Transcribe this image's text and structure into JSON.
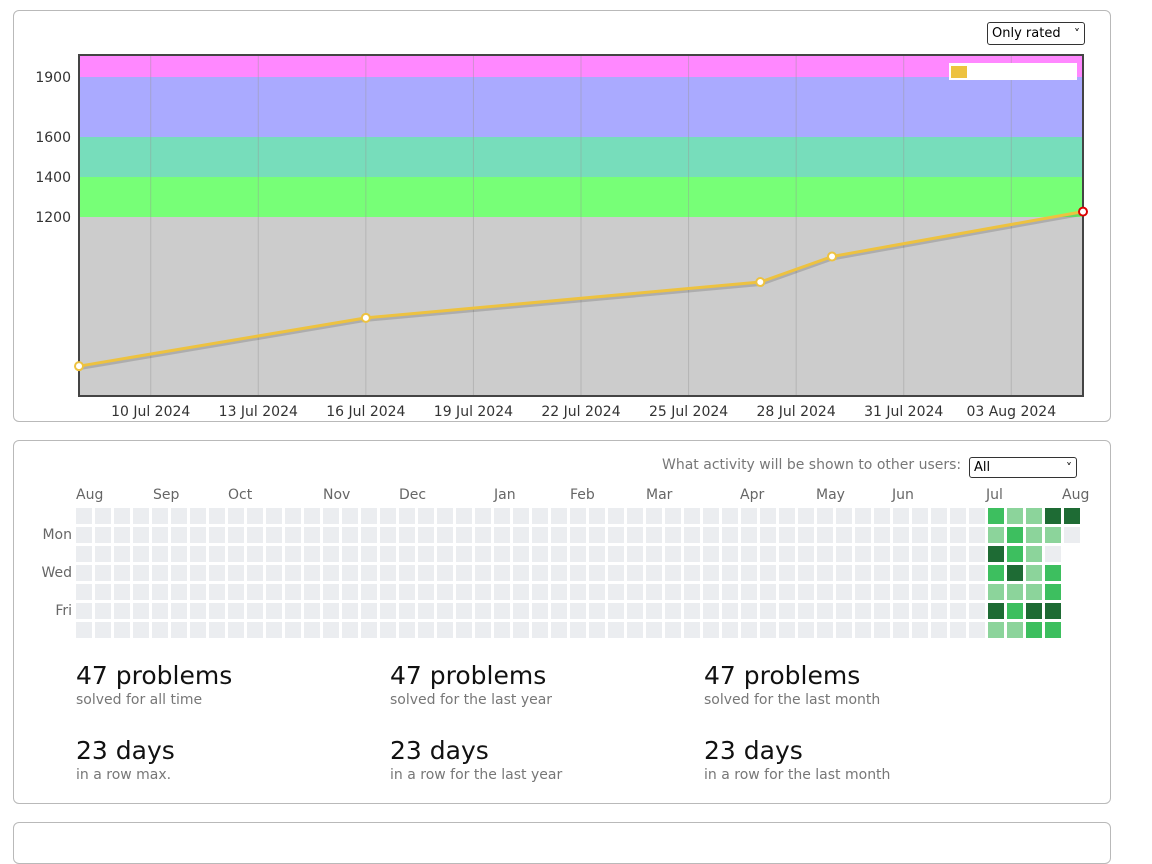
{
  "rating": {
    "filter": {
      "selected": "Only rated"
    },
    "chart_data": {
      "type": "line",
      "title": "",
      "ylabel": "",
      "xlabel": "",
      "y_ticks": [
        1200,
        1400,
        1600,
        1900
      ],
      "x_tick_labels": [
        "10 Jul 2024",
        "13 Jul 2024",
        "16 Jul 2024",
        "19 Jul 2024",
        "22 Jul 2024",
        "25 Jul 2024",
        "28 Jul 2024",
        "31 Jul 2024",
        "03 Aug 2024"
      ],
      "bands": [
        {
          "from": 0,
          "to": 1200,
          "color": "#cccccc"
        },
        {
          "from": 1200,
          "to": 1400,
          "color": "#77ff77"
        },
        {
          "from": 1400,
          "to": 1600,
          "color": "#77ddbb"
        },
        {
          "from": 1600,
          "to": 1900,
          "color": "#aaaaff"
        },
        {
          "from": 1900,
          "to": 2100,
          "color": "#ff88ff"
        }
      ],
      "series": [
        {
          "color": "#edc240",
          "points": [
            {
              "x": "2024-07-08",
              "y": 200
            },
            {
              "x": "2024-07-16",
              "y": 524
            },
            {
              "x": "2024-07-27",
              "y": 764
            },
            {
              "x": "2024-07-29",
              "y": 935
            },
            {
              "x": "2024-08-05",
              "y": 1227
            }
          ]
        }
      ]
    }
  },
  "activity": {
    "visibility_label": "What activity will be shown to other users:",
    "visibility_selected": "All",
    "months": [
      "Aug",
      "Sep",
      "Oct",
      "Nov",
      "Dec",
      "Jan",
      "Feb",
      "Mar",
      "Apr",
      "May",
      "Jun",
      "Jul",
      "Aug"
    ],
    "day_names": [
      "Mon",
      "Wed",
      "Fri"
    ],
    "colors": {
      "empty": "#ebedf0",
      "l1": "#8cd49b",
      "l2": "#3dbf5f",
      "l3": "#1e6b34"
    },
    "active_weeks": [
      [
        2,
        1,
        3,
        2,
        1,
        3,
        1
      ],
      [
        1,
        2,
        2,
        3,
        1,
        2,
        1
      ],
      [
        1,
        1,
        1,
        1,
        1,
        3,
        2
      ],
      [
        3,
        1,
        0,
        2,
        2,
        3,
        2
      ],
      [
        3,
        0,
        null,
        null,
        null,
        null,
        null
      ]
    ],
    "stats": [
      {
        "value": "47 problems",
        "caption": "solved for all time"
      },
      {
        "value": "47 problems",
        "caption": "solved for the last year"
      },
      {
        "value": "47 problems",
        "caption": "solved for the last month"
      },
      {
        "value": "23 days",
        "caption": "in a row max."
      },
      {
        "value": "23 days",
        "caption": "in a row for the last year"
      },
      {
        "value": "23 days",
        "caption": "in a row for the last month"
      }
    ]
  }
}
